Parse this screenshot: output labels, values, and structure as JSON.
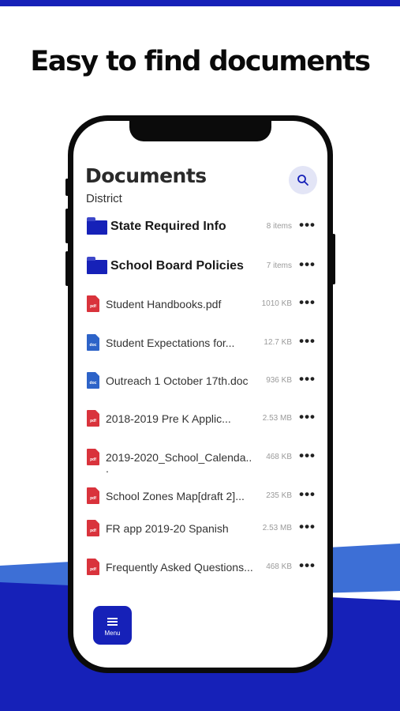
{
  "headline": "Easy to find documents",
  "colors": {
    "brand": "#1621b8",
    "accent_light": "#3d6fd6",
    "pdf": "#d9333c",
    "doc": "#2d63c8"
  },
  "screen": {
    "title": "Documents",
    "subtitle": "District",
    "search_icon": "search-icon",
    "folders": [
      {
        "name": "State Required Info",
        "meta": "8 items",
        "icon": "folder-icon"
      },
      {
        "name": "School Board Policies",
        "meta": "7 items",
        "icon": "folder-icon"
      }
    ],
    "files": [
      {
        "name": "Student Handbooks.pdf",
        "size": "1010 KB",
        "type": "pdf",
        "badge": "pdf"
      },
      {
        "name": "Student Expectations for...",
        "size": "12.7 KB",
        "type": "doc",
        "badge": "doc"
      },
      {
        "name": "Outreach 1 October 17th.doc",
        "size": "936 KB",
        "type": "doc",
        "badge": "doc"
      },
      {
        "name": "2018-2019 Pre K Applic...",
        "size": "2.53 MB",
        "type": "pdf",
        "badge": "pdf"
      },
      {
        "name": "2019-2020_School_Calenda..",
        "size": "468 KB",
        "type": "pdf",
        "badge": "pdf",
        "wrap": "."
      },
      {
        "name": "School Zones Map[draft 2]...",
        "size": "235 KB",
        "type": "pdf",
        "badge": "pdf"
      },
      {
        "name": "FR app 2019-20 Spanish",
        "size": "2.53 MB",
        "type": "pdf",
        "badge": "pdf"
      },
      {
        "name": "Frequently Asked Questions...",
        "size": "468 KB",
        "type": "pdf",
        "badge": "pdf"
      }
    ],
    "more_label": "•••",
    "menu_label": "Menu"
  }
}
